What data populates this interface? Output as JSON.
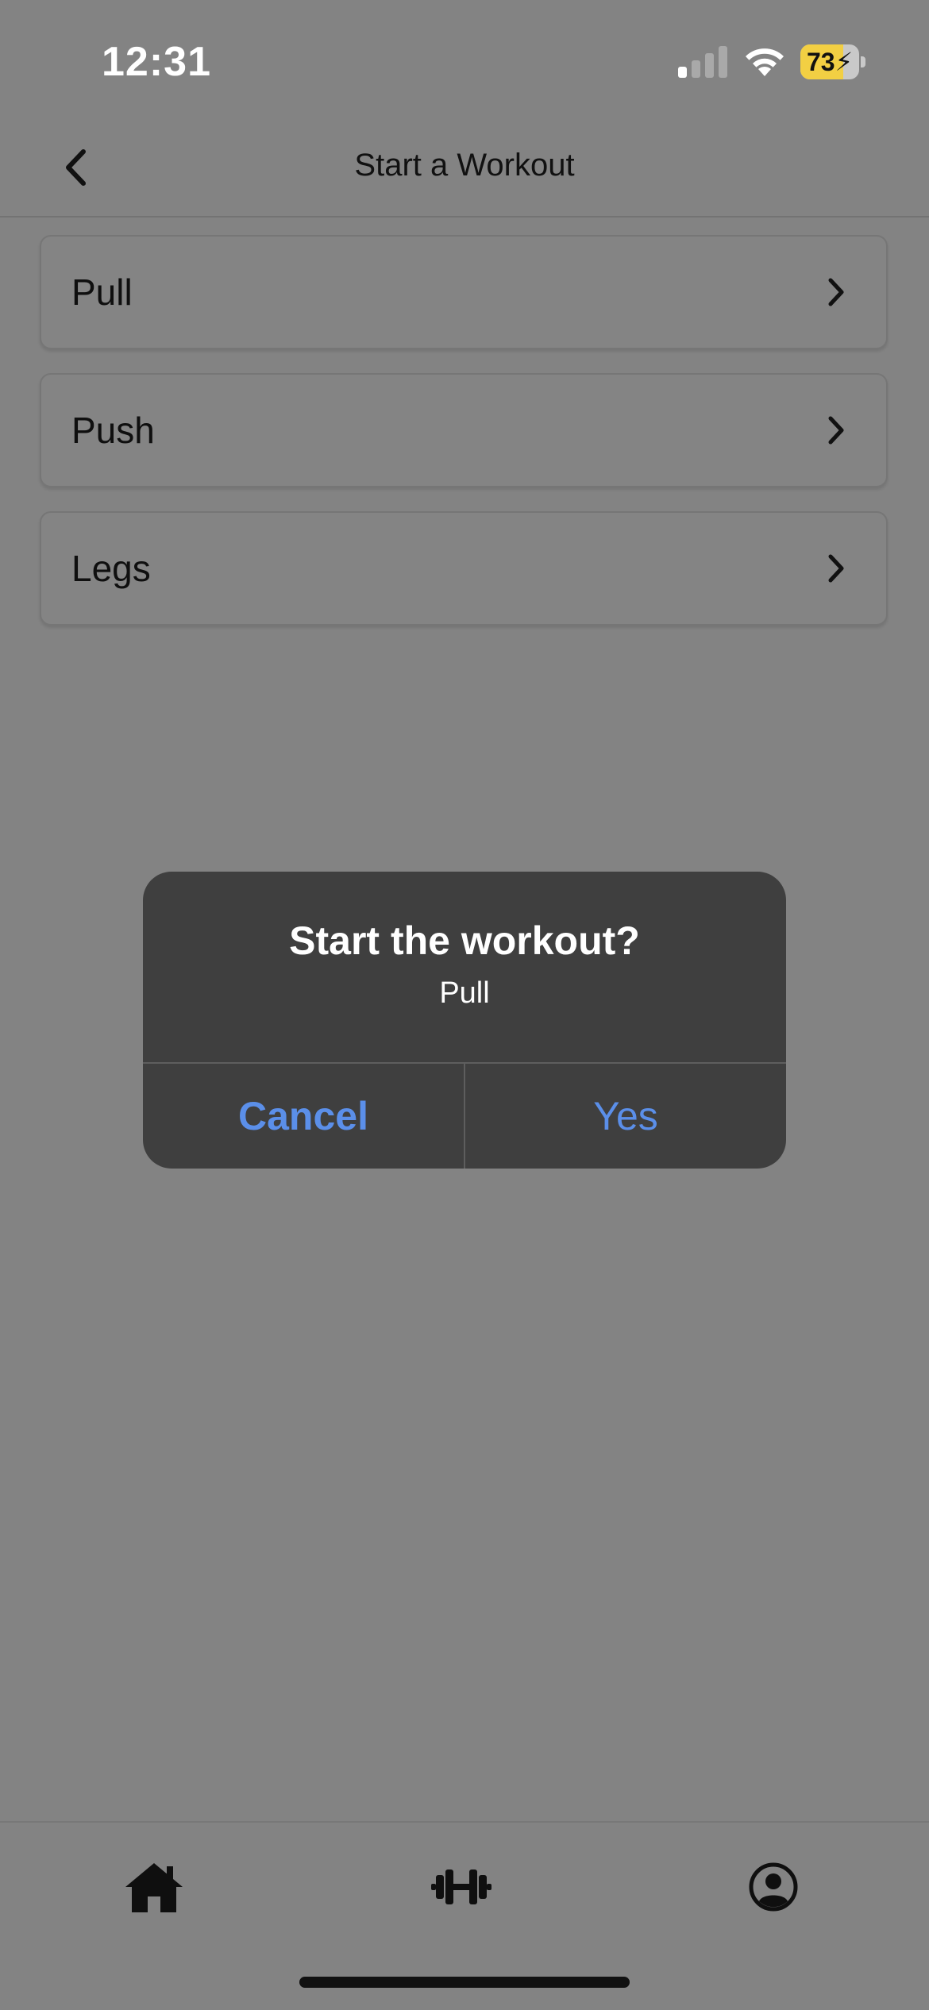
{
  "status_bar": {
    "time": "12:31",
    "battery_level": "73",
    "battery_fraction": 0.73,
    "battery_charging": true,
    "signal_bars_active": 1,
    "signal_bars_total": 4,
    "battery_color": "#f2cf43"
  },
  "nav": {
    "title": "Start a Workout",
    "back_icon": "chevron-left-icon"
  },
  "workouts": [
    {
      "name": "Pull",
      "icon": "chevron-right-icon"
    },
    {
      "name": "Push",
      "icon": "chevron-right-icon"
    },
    {
      "name": "Legs",
      "icon": "chevron-right-icon"
    }
  ],
  "alert": {
    "title": "Start the workout?",
    "message": "Pull",
    "cancel_label": "Cancel",
    "confirm_label": "Yes",
    "button_color": "#5b8fe9"
  },
  "tab_bar": {
    "items": [
      {
        "icon": "home-icon"
      },
      {
        "icon": "dumbbell-icon"
      },
      {
        "icon": "profile-icon"
      }
    ]
  }
}
